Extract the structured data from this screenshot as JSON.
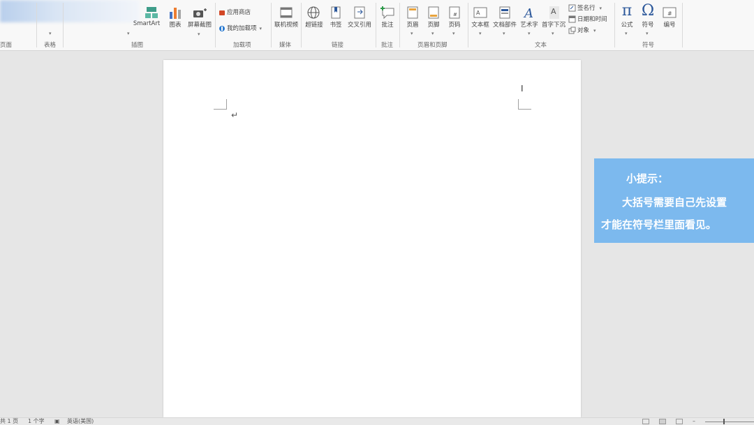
{
  "ribbon": {
    "groups": {
      "pages": "页面",
      "tables": "表格",
      "illustrations": "插图",
      "addins": "加载项",
      "media": "媒体",
      "links": "链接",
      "comments": "批注",
      "header_footer": "页眉和页脚",
      "text": "文本",
      "symbols": "符号"
    },
    "buttons": {
      "smartart": "SmartArt",
      "chart": "图表",
      "screenshot": "屏幕截图",
      "app_store": "应用商店",
      "my_addins": "我的加载项",
      "online_video": "联机视频",
      "hyperlink": "超链接",
      "bookmark": "书签",
      "cross_reference": "交叉引用",
      "comment": "批注",
      "header": "页眉",
      "footer": "页脚",
      "page_number": "页码",
      "text_box": "文本框",
      "quick_parts": "文档部件",
      "wordart": "艺术字",
      "drop_cap": "首字下沉",
      "signature_line": "签名行",
      "date_time": "日期和时间",
      "object": "对象",
      "equation": "公式",
      "symbol": "符号",
      "numbering": "编号"
    }
  },
  "tip": {
    "title": "小提示：",
    "line1": "大括号需要自己先设置",
    "line2": "才能在符号栏里面看见。"
  },
  "statusbar": {
    "pages": "共 1 页",
    "words": "1 个字",
    "language": "英语(美国)"
  },
  "colors": {
    "tip_bg": "#7cb9ee",
    "accent_blue": "#2b579a"
  }
}
